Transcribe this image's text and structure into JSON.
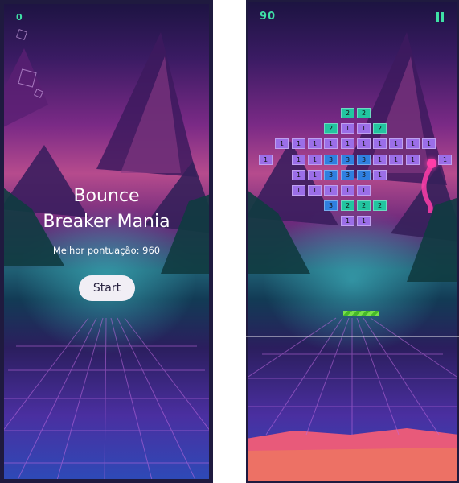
{
  "menu_screen": {
    "score": "0",
    "title_line1": "Bounce",
    "title_line2": "Breaker Mania",
    "best_score": "Melhor pontuação: 960",
    "start_label": "Start"
  },
  "game_screen": {
    "score": "90",
    "pause_icon": "pause-icon",
    "bricks": [
      {
        "row": 0,
        "col": 5,
        "hits": "2",
        "color": "#22c5a0"
      },
      {
        "row": 0,
        "col": 6,
        "hits": "2",
        "color": "#22c5a0"
      },
      {
        "row": 1,
        "col": 4,
        "hits": "2",
        "color": "#22c5a0"
      },
      {
        "row": 1,
        "col": 5,
        "hits": "1",
        "color": "#9b6ee8"
      },
      {
        "row": 1,
        "col": 6,
        "hits": "1",
        "color": "#9b6ee8"
      },
      {
        "row": 1,
        "col": 7,
        "hits": "2",
        "color": "#22c5a0"
      },
      {
        "row": 2,
        "col": 1,
        "hits": "1",
        "color": "#9b6ee8"
      },
      {
        "row": 2,
        "col": 2,
        "hits": "1",
        "color": "#9b6ee8"
      },
      {
        "row": 2,
        "col": 3,
        "hits": "1",
        "color": "#9b6ee8"
      },
      {
        "row": 2,
        "col": 4,
        "hits": "1",
        "color": "#9b6ee8"
      },
      {
        "row": 2,
        "col": 5,
        "hits": "1",
        "color": "#9b6ee8"
      },
      {
        "row": 2,
        "col": 6,
        "hits": "1",
        "color": "#9b6ee8"
      },
      {
        "row": 2,
        "col": 7,
        "hits": "1",
        "color": "#9b6ee8"
      },
      {
        "row": 2,
        "col": 8,
        "hits": "1",
        "color": "#9b6ee8"
      },
      {
        "row": 2,
        "col": 9,
        "hits": "1",
        "color": "#9b6ee8"
      },
      {
        "row": 2,
        "col": 10,
        "hits": "1",
        "color": "#9b6ee8"
      },
      {
        "row": 3,
        "col": 0,
        "hits": "1",
        "color": "#9b6ee8"
      },
      {
        "row": 3,
        "col": 2,
        "hits": "1",
        "color": "#9b6ee8"
      },
      {
        "row": 3,
        "col": 3,
        "hits": "1",
        "color": "#9b6ee8"
      },
      {
        "row": 3,
        "col": 4,
        "hits": "3",
        "color": "#2f7fe0"
      },
      {
        "row": 3,
        "col": 5,
        "hits": "3",
        "color": "#2f7fe0"
      },
      {
        "row": 3,
        "col": 6,
        "hits": "3",
        "color": "#2f7fe0"
      },
      {
        "row": 3,
        "col": 7,
        "hits": "1",
        "color": "#9b6ee8"
      },
      {
        "row": 3,
        "col": 8,
        "hits": "1",
        "color": "#9b6ee8"
      },
      {
        "row": 3,
        "col": 9,
        "hits": "1",
        "color": "#9b6ee8"
      },
      {
        "row": 3,
        "col": 11,
        "hits": "1",
        "color": "#9b6ee8"
      },
      {
        "row": 4,
        "col": 2,
        "hits": "1",
        "color": "#9b6ee8"
      },
      {
        "row": 4,
        "col": 3,
        "hits": "1",
        "color": "#9b6ee8"
      },
      {
        "row": 4,
        "col": 4,
        "hits": "3",
        "color": "#2f7fe0"
      },
      {
        "row": 4,
        "col": 5,
        "hits": "3",
        "color": "#2f7fe0"
      },
      {
        "row": 4,
        "col": 6,
        "hits": "3",
        "color": "#2f7fe0"
      },
      {
        "row": 4,
        "col": 7,
        "hits": "1",
        "color": "#9b6ee8"
      },
      {
        "row": 5,
        "col": 2,
        "hits": "1",
        "color": "#9b6ee8"
      },
      {
        "row": 5,
        "col": 3,
        "hits": "1",
        "color": "#9b6ee8"
      },
      {
        "row": 5,
        "col": 4,
        "hits": "1",
        "color": "#9b6ee8"
      },
      {
        "row": 5,
        "col": 5,
        "hits": "1",
        "color": "#9b6ee8"
      },
      {
        "row": 5,
        "col": 6,
        "hits": "1",
        "color": "#9b6ee8"
      },
      {
        "row": 6,
        "col": 4,
        "hits": "3",
        "color": "#2f7fe0"
      },
      {
        "row": 6,
        "col": 5,
        "hits": "2",
        "color": "#22c5a0"
      },
      {
        "row": 6,
        "col": 6,
        "hits": "2",
        "color": "#22c5a0"
      },
      {
        "row": 6,
        "col": 7,
        "hits": "2",
        "color": "#22c5a0"
      },
      {
        "row": 7,
        "col": 5,
        "hits": "1",
        "color": "#9b6ee8"
      },
      {
        "row": 7,
        "col": 6,
        "hits": "1",
        "color": "#9b6ee8"
      }
    ]
  },
  "colors": {
    "accent_green": "#3fe0a6",
    "brick_purple": "#9b6ee8",
    "brick_teal": "#22c5a0",
    "brick_blue": "#2f7fe0",
    "ball_pink": "#ff3da8",
    "paddle_green": "#78e04a"
  }
}
